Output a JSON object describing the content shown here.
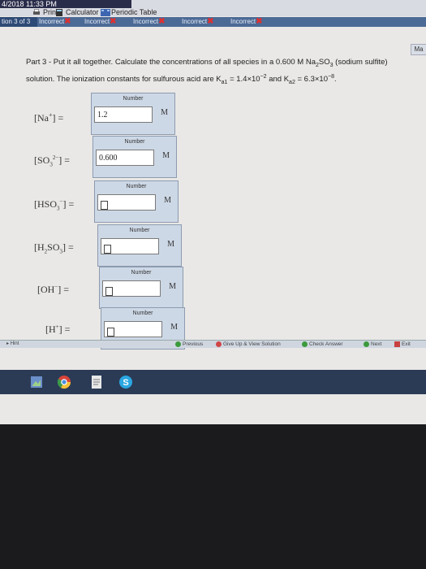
{
  "clock": "4/2018 11:33 PM",
  "toolbar": {
    "print": "Print",
    "calculator": "Calculator",
    "periodic": "Periodic Table"
  },
  "tabs": {
    "label": "tion 3 of 3",
    "items": [
      "Incorrect",
      "Incorrect",
      "Incorrect",
      "Incorrect",
      "Incorrect"
    ]
  },
  "mbutton": "Ma",
  "question": {
    "prefix": "Part 3 - Put it all together. Calculate the concentrations of all species in a 0.600 M Na",
    "tail": "SO",
    "tail2": " (sodium sulfite) solution. The ionization constants for sulfurous acid are K",
    "ka1_sub": "a1",
    "mid": " = 1.4×10",
    "exp1": "−2",
    "and": " and K",
    "ka2_sub": "a2",
    "mid2": " = 6.3×10",
    "exp2": "−8",
    "end": "."
  },
  "fields": [
    {
      "label": "Number",
      "value": "1.2",
      "unit": "M"
    },
    {
      "label": "Number",
      "value": "0.600",
      "unit": "M"
    },
    {
      "label": "Number",
      "value": "",
      "unit": "M"
    },
    {
      "label": "Number",
      "value": "",
      "unit": "M"
    },
    {
      "label": "Number",
      "value": "",
      "unit": "M"
    },
    {
      "label": "Number",
      "value": "",
      "unit": "M"
    }
  ],
  "species": [
    "Na",
    "SO",
    "HSO",
    "H",
    "OH",
    "H"
  ],
  "bottom": {
    "hint": "Hint",
    "previous": "Previous",
    "giveup": "Give Up & View Solution",
    "check": "Check Answer",
    "next": "Next",
    "exit": "Exit"
  }
}
